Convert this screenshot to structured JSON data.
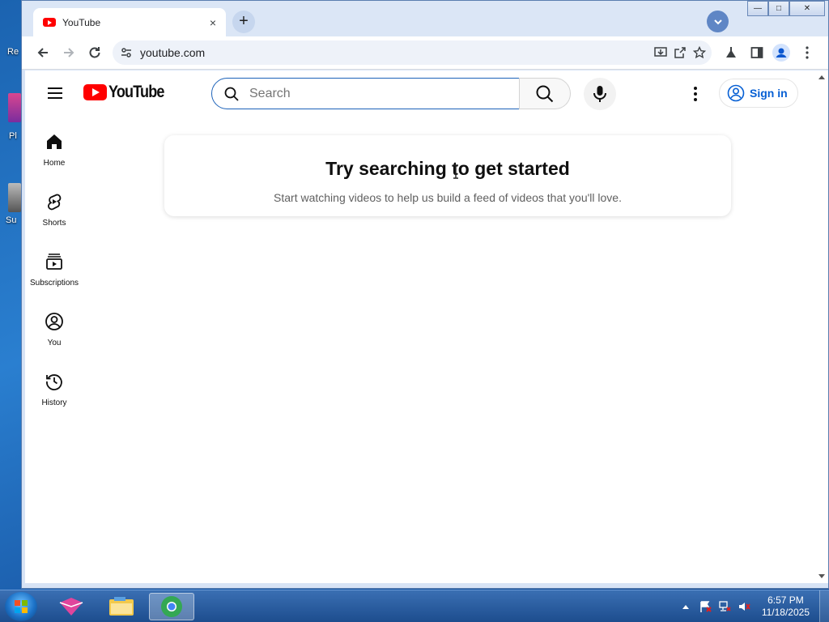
{
  "desktop": {
    "icon_labels": [
      "Re",
      "Pl",
      "Su"
    ]
  },
  "browser": {
    "tab": {
      "title": "YouTube",
      "close_glyph": "×"
    },
    "new_tab_glyph": "+",
    "window_controls": {
      "minimize": "—",
      "maximize": "□",
      "close": "✕"
    },
    "toolbar": {
      "url": "youtube.com",
      "icons": [
        "back-icon",
        "forward-icon",
        "reload-icon",
        "site-info-icon",
        "install-app-icon",
        "share-icon",
        "bookmark-star-icon",
        "labs-icon",
        "side-panel-icon",
        "profile-icon",
        "menu-kebab-icon"
      ]
    }
  },
  "youtube": {
    "logo_text": "YouTube",
    "search": {
      "placeholder": "Search",
      "value": ""
    },
    "sign_in_label": "Sign in",
    "guide": [
      {
        "label": "Home",
        "icon": "home-icon"
      },
      {
        "label": "Shorts",
        "icon": "shorts-icon"
      },
      {
        "label": "Subscriptions",
        "icon": "subscriptions-icon"
      },
      {
        "label": "You",
        "icon": "you-icon"
      },
      {
        "label": "History",
        "icon": "history-icon"
      }
    ],
    "prompt": {
      "title": "Try searching to get started",
      "subtitle": "Start watching videos to help us build a feed of videos that you'll love."
    },
    "colors": {
      "brand_red": "#ff0000",
      "link_blue": "#065fd4",
      "search_focus": "#1c62b9"
    }
  },
  "taskbar": {
    "clock": {
      "time": "6:57 PM",
      "date": "11/18/2025"
    },
    "apps": [
      "paint-app-icon",
      "file-explorer-icon",
      "browser-app-icon"
    ]
  }
}
